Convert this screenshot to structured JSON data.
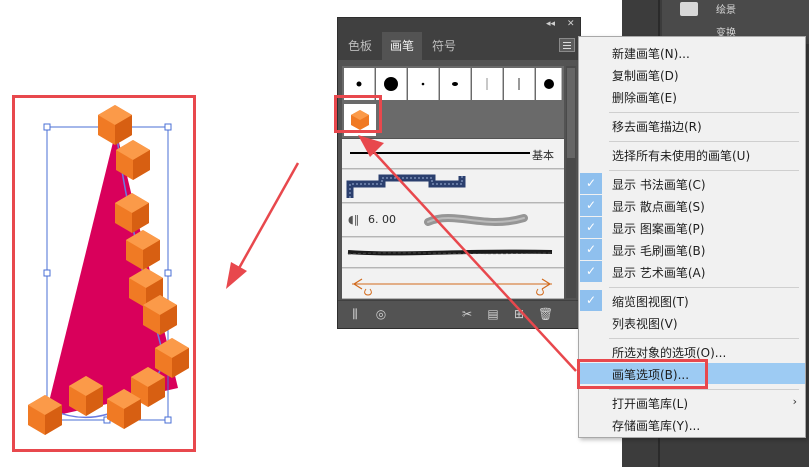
{
  "app_strip": {
    "item1": "绘景",
    "item2": "变换"
  },
  "brush_panel": {
    "tabs": [
      {
        "label": "色板",
        "active": false
      },
      {
        "label": "画笔",
        "active": true
      },
      {
        "label": "符号",
        "active": false
      }
    ],
    "basic_label": "基本",
    "scatter_size": "6. 00"
  },
  "context_menu": {
    "items": [
      {
        "label": "新建画笔(N)..."
      },
      {
        "label": "复制画笔(D)"
      },
      {
        "label": "删除画笔(E)"
      },
      {
        "label": "移去画笔描边(R)"
      },
      {
        "label": "选择所有未使用的画笔(U)"
      },
      {
        "label": "显示 书法画笔(C)"
      },
      {
        "label": "显示 散点画笔(S)"
      },
      {
        "label": "显示 图案画笔(P)"
      },
      {
        "label": "显示 毛刷画笔(B)"
      },
      {
        "label": "显示 艺术画笔(A)"
      },
      {
        "label": "缩览图视图(T)"
      },
      {
        "label": "列表视图(V)"
      },
      {
        "label": "所选对象的选项(O)..."
      },
      {
        "label": "画笔选项(B)..."
      },
      {
        "label": "打开画笔库(L)"
      },
      {
        "label": "存储画笔库(Y)..."
      }
    ]
  },
  "colors": {
    "accent_red": "#e8484d",
    "highlight_blue": "#9dcbf3",
    "shape_magenta": "#d9005b",
    "hex_orange": "#f07a24"
  }
}
